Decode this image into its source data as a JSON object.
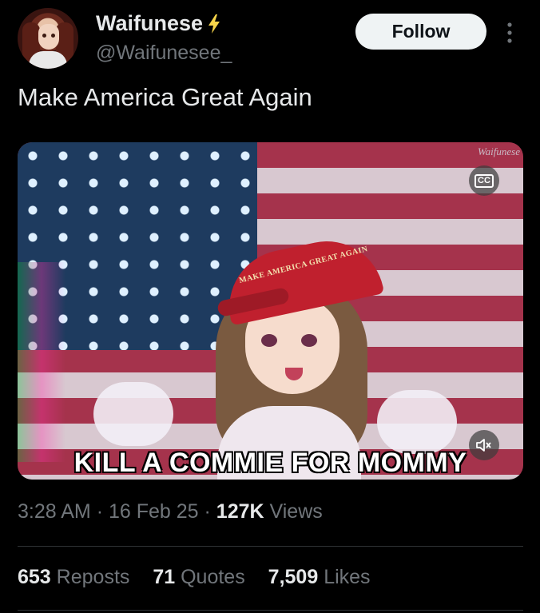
{
  "author": {
    "display_name": "Waifunese",
    "handle": "@Waifunesee_",
    "verified_badge_icon": "lightning-bolt-icon",
    "badge_color": "#f7d54a"
  },
  "header": {
    "follow_label": "Follow",
    "more_icon": "more-vertical-icon"
  },
  "tweet": {
    "text": "Make America Great Again"
  },
  "media": {
    "type": "video",
    "watermark": "Waifunese",
    "hat_text": "MAKE AMERICA GREAT AGAIN",
    "caption": "KILL A COMMIE FOR MOMMY",
    "cc_label": "CC",
    "mute_icon": "speaker-muted-icon"
  },
  "meta": {
    "time": "3:28 AM",
    "date": "16 Feb 25",
    "views_count": "127K",
    "views_label": "Views",
    "separator": "·"
  },
  "stats": {
    "reposts_count": "653",
    "reposts_label": "Reposts",
    "quotes_count": "71",
    "quotes_label": "Quotes",
    "likes_count": "7,509",
    "likes_label": "Likes"
  },
  "colors": {
    "background": "#000000",
    "text_primary": "#e7e9ea",
    "text_secondary": "#71767b",
    "follow_button_bg": "#eff3f4"
  }
}
